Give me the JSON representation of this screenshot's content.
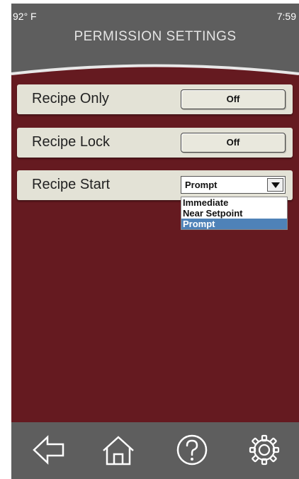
{
  "status": {
    "temperature": "92° F",
    "time": "7:59"
  },
  "header": {
    "title": "PERMISSION SETTINGS"
  },
  "settings": [
    {
      "label": "Recipe Only",
      "value": "Off"
    },
    {
      "label": "Recipe Lock",
      "value": "Off"
    },
    {
      "label": "Recipe Start",
      "value": "Prompt",
      "options": [
        "Immediate",
        "Near Setpoint",
        "Prompt"
      ],
      "selected_option": "Prompt"
    }
  ],
  "colors": {
    "background": "#651a20",
    "header": "#5e5e5e",
    "row": "#e3e2d6",
    "selected_option": "#4f82b8"
  },
  "nav": {
    "icons": [
      "back-arrow-icon",
      "home-icon",
      "help-icon",
      "gear-icon"
    ]
  }
}
